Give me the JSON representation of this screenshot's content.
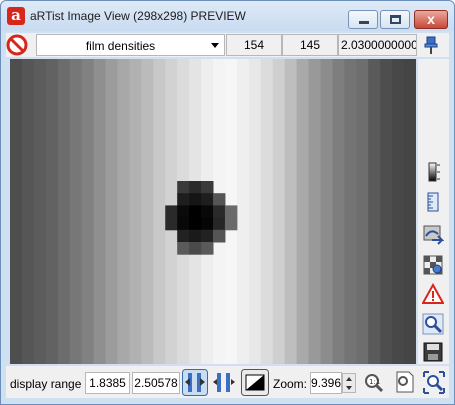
{
  "window": {
    "logo_letter": "a",
    "title": "aRTist Image View (298x298) PREVIEW",
    "close_glyph": "x"
  },
  "toolbar": {
    "dropdown_value": "film densities",
    "field_1": "154",
    "field_2": "145",
    "field_3": "2.0300000000000"
  },
  "image": {
    "columns": [
      "#4e4e4e",
      "#565656",
      "#5c5c5c",
      "#626262",
      "#6c6c6c",
      "#777777",
      "#818181",
      "#8f8f8f",
      "#9c9c9c",
      "#a8a8a8",
      "#b1b1b1",
      "#bbbbbb",
      "#c8c8c8",
      "#d2d2d2",
      "#dbdbdb",
      "#e4e4e4",
      "#eeeeee",
      "#f4f4f4",
      "#f6f6f6",
      "#efefef",
      "#e8e8e8",
      "#dcdcdc",
      "#cfcfcf",
      "#bebebe",
      "#a9a9a9",
      "#999999",
      "#8c8c8c",
      "#7e7e7e",
      "#747474",
      "#6e6e6e",
      "#5a5a5a",
      "#4e4e4e",
      "#484848",
      "#454545"
    ],
    "defect": [
      {
        "row": 10,
        "col": 14,
        "gray": "#3a3a3a"
      },
      {
        "row": 10,
        "col": 15,
        "gray": "#2a2a2a"
      },
      {
        "row": 10,
        "col": 16,
        "gray": "#3a3a3a"
      },
      {
        "row": 11,
        "col": 14,
        "gray": "#1e1e1e"
      },
      {
        "row": 11,
        "col": 15,
        "gray": "#151515"
      },
      {
        "row": 11,
        "col": 16,
        "gray": "#1e1e1e"
      },
      {
        "row": 11,
        "col": 17,
        "gray": "#555555"
      },
      {
        "row": 12,
        "col": 13,
        "gray": "#2a2a2a"
      },
      {
        "row": 12,
        "col": 14,
        "gray": "#0a0a0a"
      },
      {
        "row": 12,
        "col": 15,
        "gray": "#000000"
      },
      {
        "row": 12,
        "col": 16,
        "gray": "#080808"
      },
      {
        "row": 12,
        "col": 17,
        "gray": "#2a2a2a"
      },
      {
        "row": 12,
        "col": 18,
        "gray": "#6a6a6a"
      },
      {
        "row": 13,
        "col": 13,
        "gray": "#2a2a2a"
      },
      {
        "row": 13,
        "col": 14,
        "gray": "#080808"
      },
      {
        "row": 13,
        "col": 15,
        "gray": "#000000"
      },
      {
        "row": 13,
        "col": 16,
        "gray": "#050505"
      },
      {
        "row": 13,
        "col": 17,
        "gray": "#262626"
      },
      {
        "row": 13,
        "col": 18,
        "gray": "#6a6a6a"
      },
      {
        "row": 14,
        "col": 14,
        "gray": "#222222"
      },
      {
        "row": 14,
        "col": 15,
        "gray": "#1a1a1a"
      },
      {
        "row": 14,
        "col": 16,
        "gray": "#222222"
      },
      {
        "row": 14,
        "col": 17,
        "gray": "#555555"
      },
      {
        "row": 15,
        "col": 14,
        "gray": "#5a5a5a"
      },
      {
        "row": 15,
        "col": 15,
        "gray": "#4a4a4a"
      },
      {
        "row": 15,
        "col": 16,
        "gray": "#5a5a5a"
      }
    ]
  },
  "bottom": {
    "display_range_label": "display range",
    "range_min": "1.8385",
    "range_max": "2.50578",
    "zoom_label": "Zoom:",
    "zoom_value": "9.396"
  },
  "colors": {
    "accent_red": "#d9261c",
    "window_frame": "#cfe0f3"
  }
}
